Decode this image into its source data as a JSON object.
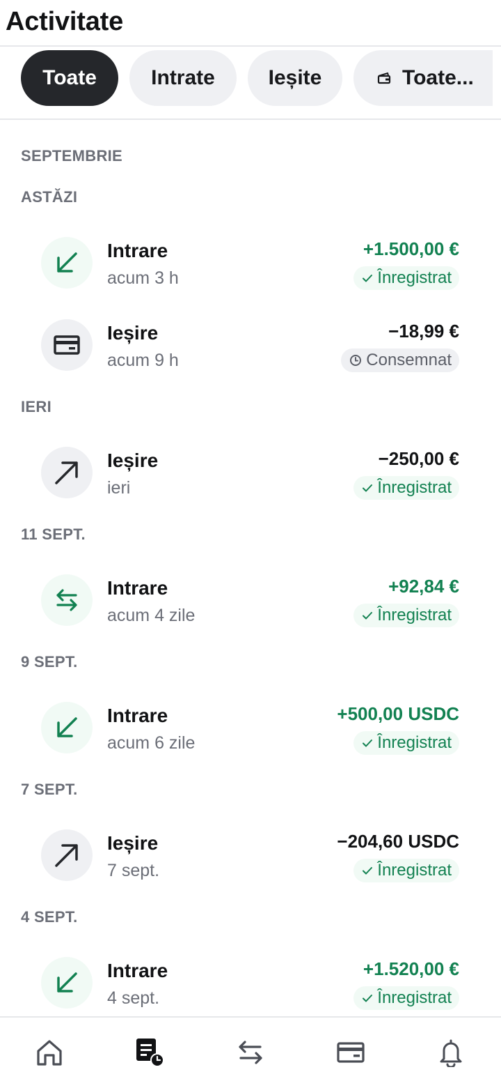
{
  "header": {
    "title": "Activitate"
  },
  "filters": [
    {
      "label": "Toate",
      "active": true
    },
    {
      "label": "Intrate",
      "active": false
    },
    {
      "label": "Ieșite",
      "active": false
    },
    {
      "label": "Toate...",
      "icon": "wallet-icon",
      "active": false
    }
  ],
  "month_label": "SEPTEMBRIE",
  "groups": [
    {
      "label": "ASTĂZI",
      "transactions": [
        {
          "title": "Intrare",
          "subtitle": "acum 3 h",
          "amount": "+1.500,00 €",
          "status": "Înregistrat",
          "icon": "arrow-down-left-icon",
          "direction": "in"
        },
        {
          "title": "Ieșire",
          "subtitle": "acum 9 h",
          "amount": "−18,99 €",
          "status": "Consemnat",
          "icon": "card-icon",
          "direction": "out"
        }
      ]
    },
    {
      "label": "IERI",
      "transactions": [
        {
          "title": "Ieșire",
          "subtitle": "ieri",
          "amount": "−250,00 €",
          "status": "Înregistrat",
          "icon": "arrow-up-right-icon",
          "direction": "out"
        }
      ]
    },
    {
      "label": "11 SEPT.",
      "transactions": [
        {
          "title": "Intrare",
          "subtitle": "acum 4 zile",
          "amount": "+92,84 €",
          "status": "Înregistrat",
          "icon": "swap-icon",
          "direction": "in"
        }
      ]
    },
    {
      "label": "9 SEPT.",
      "transactions": [
        {
          "title": "Intrare",
          "subtitle": "acum 6 zile",
          "amount": "+500,00 USDC",
          "status": "Înregistrat",
          "icon": "arrow-down-left-icon",
          "direction": "in"
        }
      ]
    },
    {
      "label": "7 SEPT.",
      "transactions": [
        {
          "title": "Ieșire",
          "subtitle": "7 sept.",
          "amount": "−204,60 USDC",
          "status": "Înregistrat",
          "icon": "arrow-up-right-icon",
          "direction": "out"
        }
      ]
    },
    {
      "label": "4 SEPT.",
      "transactions": [
        {
          "title": "Intrare",
          "subtitle": "4 sept.",
          "amount": "+1.520,00 €",
          "status": "Înregistrat",
          "icon": "arrow-down-left-icon",
          "direction": "in"
        }
      ]
    }
  ],
  "bottom_nav": [
    {
      "icon": "home-icon",
      "active": false
    },
    {
      "icon": "activity-icon",
      "active": true
    },
    {
      "icon": "transfer-icon",
      "active": false
    },
    {
      "icon": "card-icon",
      "active": false
    },
    {
      "icon": "bell-icon",
      "active": false
    }
  ],
  "colors": {
    "positive": "#128151",
    "text": "#111214",
    "muted": "#6b6e77",
    "active_chip": "#25272b",
    "chip": "#eff0f3"
  }
}
